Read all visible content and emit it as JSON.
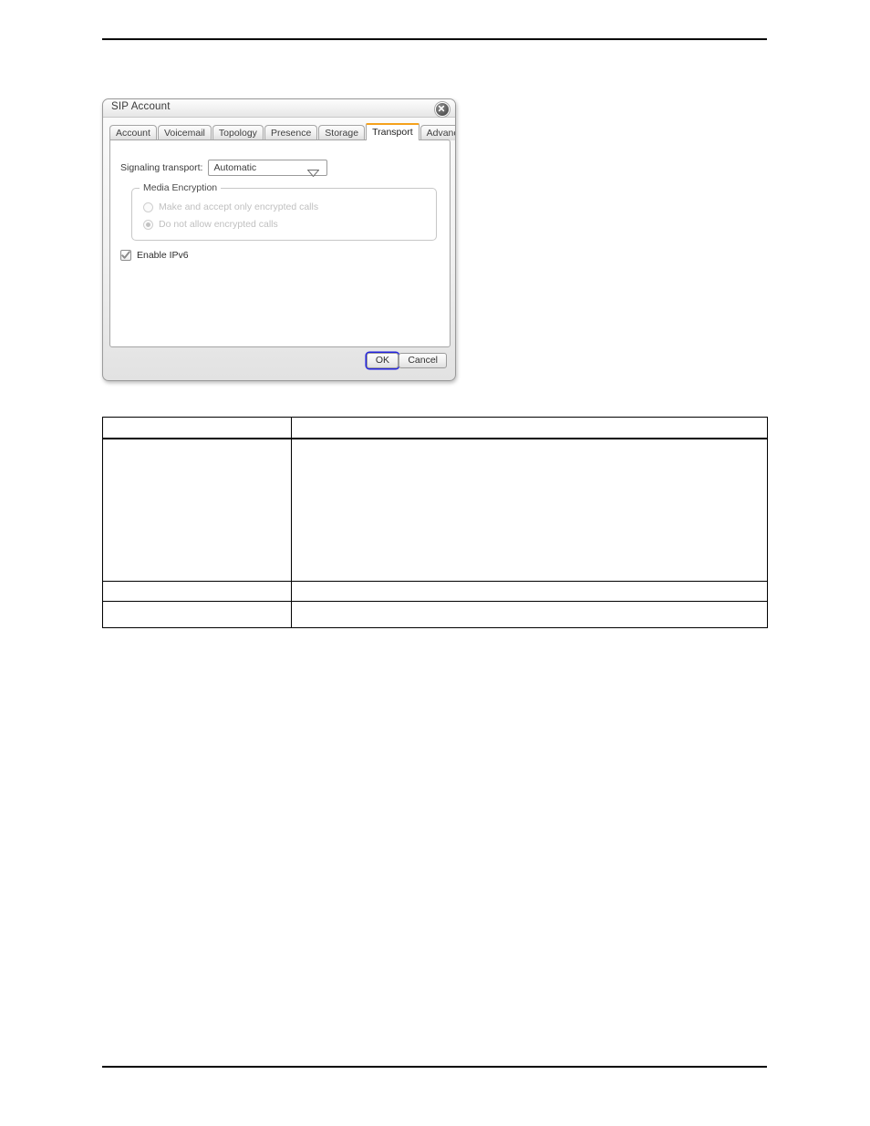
{
  "page": {
    "header_rule": true,
    "footer_rule": true
  },
  "dialog": {
    "title": "SIP Account",
    "close_icon": "close-circle-icon",
    "tabs": [
      {
        "label": "Account",
        "active": false
      },
      {
        "label": "Voicemail",
        "active": false
      },
      {
        "label": "Topology",
        "active": false
      },
      {
        "label": "Presence",
        "active": false
      },
      {
        "label": "Storage",
        "active": false
      },
      {
        "label": "Transport",
        "active": true
      },
      {
        "label": "Advanced",
        "active": false
      }
    ],
    "active_tab": "Transport",
    "accent_color": "#f5a11b",
    "panel": {
      "signaling_transport": {
        "label": "Signaling transport:",
        "value": "Automatic",
        "arrow_icon": "chevron-down-icon"
      },
      "media_encryption": {
        "legend": "Media Encryption",
        "options": [
          {
            "label": "Make and accept only encrypted calls",
            "selected": false,
            "disabled": true
          },
          {
            "label": "Do not allow encrypted calls",
            "selected": true,
            "disabled": true
          }
        ]
      },
      "enable_ipv6": {
        "label": "Enable IPv6",
        "checked": true,
        "check_icon": "check-icon"
      }
    },
    "buttons": {
      "ok": "OK",
      "cancel": "Cancel",
      "default_focus": "OK",
      "focus_color": "#2222dd"
    }
  },
  "reference_table": {
    "columns": [
      "",
      ""
    ],
    "header": [
      "",
      ""
    ],
    "rows": [
      [
        "",
        ""
      ],
      [
        "",
        ""
      ],
      [
        "",
        ""
      ]
    ]
  }
}
